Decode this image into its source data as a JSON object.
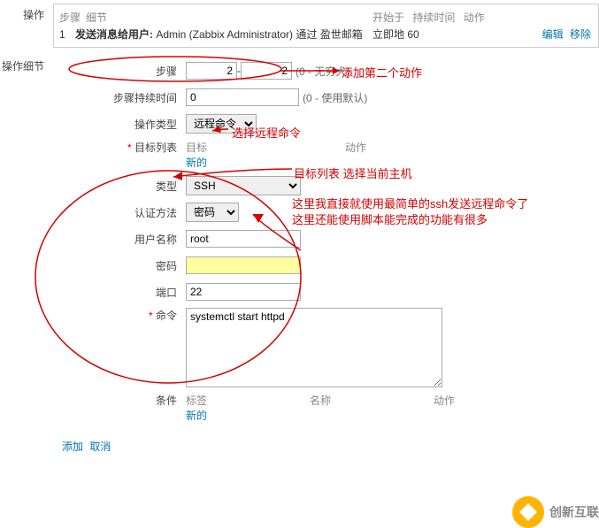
{
  "top": {
    "section_label": "操作",
    "col_step": "步骤",
    "col_detail": "细节",
    "col_start": "开始于",
    "col_duration": "持续时间",
    "col_action": "动作",
    "row_num": "1",
    "msg_prefix": "发送消息给用户:",
    "msg_user": " Admin (Zabbix Administrator) ",
    "msg_via": "通过 盈世邮箱",
    "start_val": "立即地",
    "dur_val": "60",
    "edit": "编辑",
    "remove": "移除"
  },
  "details_label": "操作细节",
  "steps": {
    "label": "步骤",
    "from": "2",
    "to": "2",
    "suffix": "(0 - 无穷大)"
  },
  "duration": {
    "label": "步骤持续时间",
    "value": "0",
    "suffix": "(0 - 使用默认)"
  },
  "optype": {
    "label": "操作类型",
    "value": "远程命令"
  },
  "target": {
    "label": "目标列表",
    "col_target": "目标",
    "col_action": "动作",
    "new": "新的"
  },
  "type": {
    "label": "类型",
    "value": "SSH"
  },
  "auth": {
    "label": "认证方法",
    "value": "密码"
  },
  "user": {
    "label": "用户名称",
    "value": "root"
  },
  "pw": {
    "label": "密码",
    "value": ""
  },
  "port": {
    "label": "端口",
    "value": "22"
  },
  "cmd": {
    "label": "命令",
    "value": "systemctl start httpd"
  },
  "cond": {
    "label": "条件",
    "col_tag": "标签",
    "col_name": "名称",
    "col_action": "动作",
    "new": "新的"
  },
  "bottom": {
    "add": "添加",
    "cancel": "取消"
  },
  "ann": {
    "a1": "添加第二个动作",
    "a2": "选择远程命令",
    "a3": "目标列表 选择当前主机",
    "a4": "这里我直接就使用最简单的ssh发送远程命令了",
    "a5": "这里还能使用脚本能完成的功能有很多"
  },
  "watermark": "创新互联"
}
